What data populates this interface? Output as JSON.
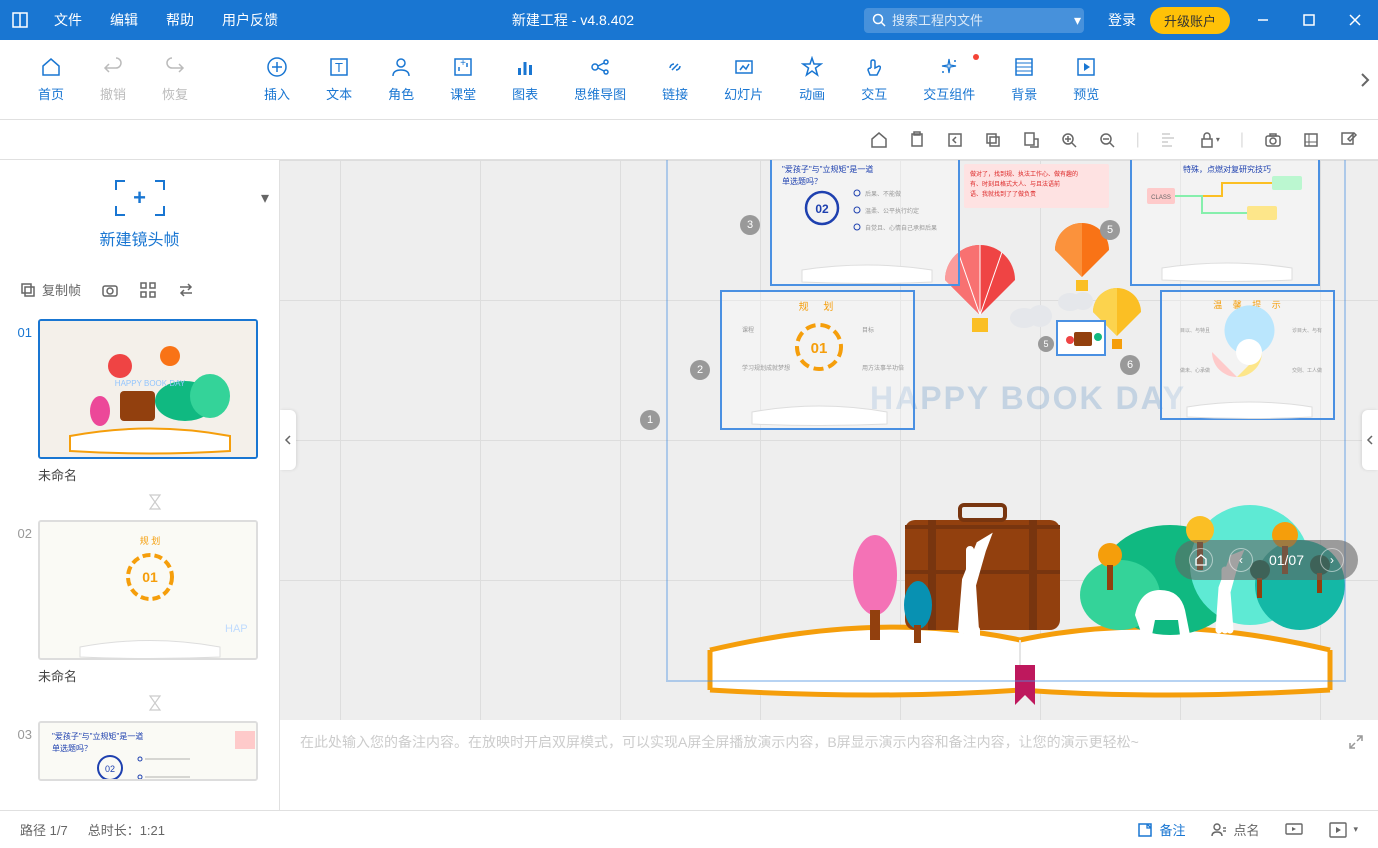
{
  "title": {
    "app_title": "新建工程 - v4.8.402",
    "menu": {
      "file": "文件",
      "edit": "编辑",
      "help": "帮助",
      "feedback": "用户反馈"
    },
    "search_placeholder": "搜索工程内文件",
    "login": "登录",
    "upgrade": "升级账户"
  },
  "toolbar": {
    "home": "首页",
    "undo": "撤销",
    "redo": "恢复",
    "insert": "插入",
    "text": "文本",
    "role": "角色",
    "classroom": "课堂",
    "chart": "图表",
    "mindmap": "思维导图",
    "link": "链接",
    "slideshow": "幻灯片",
    "animation": "动画",
    "interaction": "交互",
    "component": "交互组件",
    "background": "背景",
    "preview": "预览"
  },
  "leftpanel": {
    "new_frame": "新建镜头帧",
    "copy_frame": "复制帧"
  },
  "slides": [
    {
      "num": "01",
      "name": "未命名"
    },
    {
      "num": "02",
      "name": "未命名"
    },
    {
      "num": "03",
      "name": ""
    }
  ],
  "canvas": {
    "happy_text": "HAPPY BOOK DAY",
    "frame_labels": {
      "f1": "1",
      "f2": "2",
      "f3": "3",
      "f5": "5",
      "f6": "6"
    },
    "frame2_title": "规  划",
    "frame2_num": "01",
    "frame3_title": "\"爱孩子\"与\"立规矩\"是一道单选题吗？",
    "frame3_num": "02",
    "frame5_title": "特殊，点燃对复研究技巧",
    "frame6_title": "温 馨 提 示"
  },
  "page_indicator": {
    "current_total": "01/07"
  },
  "notes": {
    "placeholder": "在此处输入您的备注内容。在放映时开启双屏模式，可以实现A屏全屏播放演示内容，B屏显示演示内容和备注内容，让您的演示更轻松~"
  },
  "status": {
    "path": "路径 1/7",
    "total_time": "总时长：1:21",
    "notes": "备注",
    "named": "点名"
  }
}
